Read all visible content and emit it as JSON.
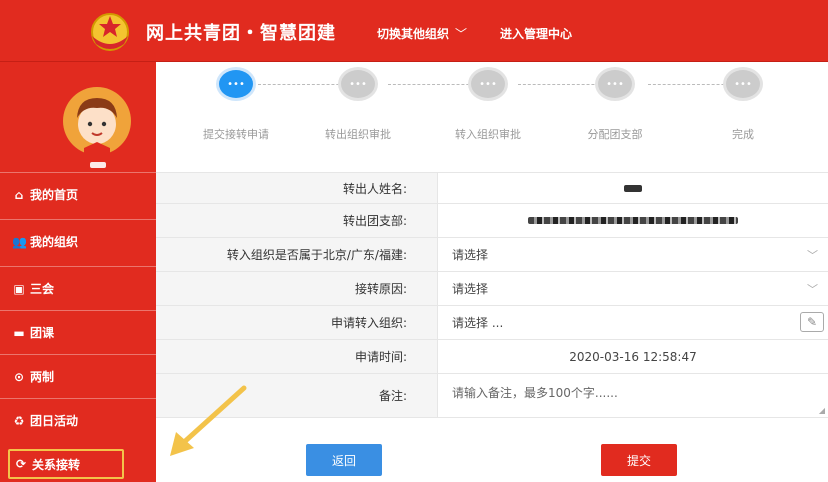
{
  "header": {
    "brand": "网上共青团・智慧团建",
    "switch_org": "切换其他组织",
    "admin_center": "进入管理中心"
  },
  "sidebar": {
    "items": [
      {
        "label": "我的首页",
        "icon": "home-icon"
      },
      {
        "label": "我的组织",
        "icon": "group-icon"
      },
      {
        "label": "三会",
        "icon": "meeting-icon"
      },
      {
        "label": "团课",
        "icon": "folder-icon"
      },
      {
        "label": "两制",
        "icon": "target-icon"
      },
      {
        "label": "团日活动",
        "icon": "recycle-icon"
      },
      {
        "label": "关系接转",
        "icon": "refresh-icon"
      }
    ]
  },
  "steps": [
    {
      "label": "提交接转申请",
      "active": true
    },
    {
      "label": "转出组织审批",
      "active": false
    },
    {
      "label": "转入组织审批",
      "active": false
    },
    {
      "label": "分配团支部",
      "active": false
    },
    {
      "label": "完成",
      "active": false
    }
  ],
  "form": {
    "out_name_label": "转出人姓名:",
    "out_branch_label": "转出团支部:",
    "region_label": "转入组织是否属于北京/广东/福建:",
    "region_placeholder": "请选择",
    "reason_label": "接转原因:",
    "reason_placeholder": "请选择",
    "target_org_label": "申请转入组织:",
    "target_org_placeholder": "请选择 ...",
    "apply_time_label": "申请时间:",
    "apply_time_value": "2020-03-16 12:58:47",
    "remark_label": "备注:",
    "remark_placeholder": "请输入备注，最多100个字......",
    "required_mark": "•"
  },
  "buttons": {
    "back": "返回",
    "submit": "提交"
  },
  "colors": {
    "brand_red": "#e12b1f",
    "step_active": "#2196f3",
    "back_button": "#3a8fe3",
    "highlight_box": "#f3c34a"
  }
}
